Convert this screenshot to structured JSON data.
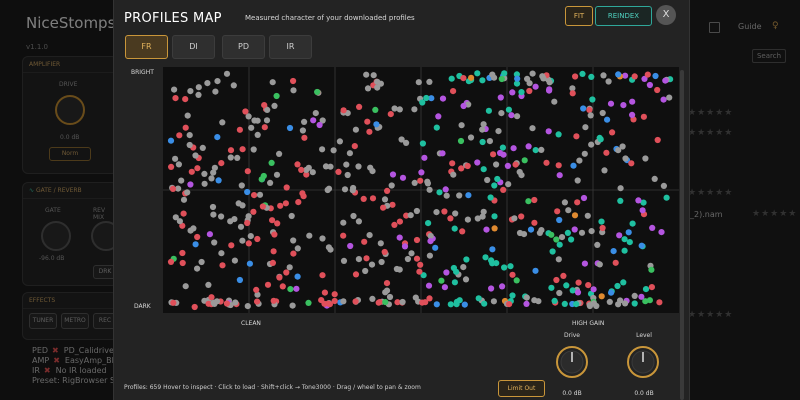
{
  "app": {
    "title": "NiceStomps!",
    "version": "v1.1.0",
    "amplifier_label": "AMPLIFIER",
    "drive_label": "DRIVE",
    "drive_value": "0.0 dB",
    "norm_label": "Norm",
    "gate_label": "GATE / REVERB",
    "gate_knob": "GATE",
    "rev_knob": "REV MIX",
    "gate_value": "-96.0 dB",
    "drk_label": "DRK",
    "effects_label": "EFFECTS",
    "tuner_label": "TUNER",
    "metro_label": "METRO",
    "rec_label": "REC",
    "status": [
      {
        "key": "PED",
        "value": "PD_Calidrive"
      },
      {
        "key": "AMP",
        "value": "EasyAmp_Bl"
      },
      {
        "key": "IR",
        "value": "No IR loaded"
      }
    ],
    "preset": "Preset: RigBrowser Star",
    "guide_label": "Guide",
    "search_label": "Search",
    "list_name": "_2).nam",
    "star_glyphs": "★★★★★"
  },
  "modal": {
    "title": "PROFILES MAP",
    "subtitle": "Measured character of your downloaded profiles",
    "fit_label": "FIT",
    "reindex_label": "REINDEX",
    "close_label": "X",
    "tabs": [
      {
        "label": "FR",
        "active": true
      },
      {
        "label": "DI",
        "active": false
      },
      {
        "label": "PD",
        "active": false
      },
      {
        "label": "IR",
        "active": false
      }
    ],
    "axes": {
      "top": "BRIGHT",
      "bottom": "DARK",
      "left": "CLEAN",
      "right": "HIGH GAIN"
    },
    "footer": "Profiles: 659   Hover to inspect  ·  Click to load  ·  Shift+click → Tone3000  ·  Drag / wheel to pan & zoom",
    "limit_label": "Limit Out",
    "knobs": [
      {
        "label": "Drive",
        "value": "0.0 dB",
        "level": 0.5
      },
      {
        "label": "Level",
        "value": "0.0 dB",
        "level": 0.5
      }
    ],
    "profile_count": 659,
    "category_colors": {
      "gray": "#9a9a9a",
      "red": "#e0505a",
      "teal": "#1fc0a0",
      "purple": "#b455e0",
      "blue": "#3a8ee6",
      "green": "#3ac060",
      "orange": "#e08a30"
    },
    "accent": "#c9963a",
    "accent_teal": "#2fa89a"
  }
}
